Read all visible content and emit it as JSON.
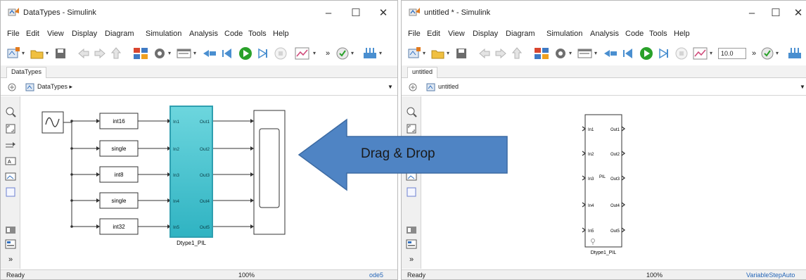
{
  "left_window": {
    "title": "DataTypes - Simulink",
    "menu": [
      "File",
      "Edit",
      "View",
      "Display",
      "Diagram",
      "Simulation",
      "Analysis",
      "Code",
      "Tools",
      "Help"
    ],
    "tab": "DataTypes",
    "address": "DataTypes",
    "status": {
      "ready": "Ready",
      "zoom": "100%",
      "solver": "ode5"
    },
    "diagram": {
      "converters": [
        "int16",
        "single",
        "int8",
        "single",
        "int32"
      ],
      "inports": [
        "In1",
        "In2",
        "In3",
        "In4",
        "In5"
      ],
      "outports": [
        "Out1",
        "Out2",
        "Out3",
        "Out4",
        "Out5"
      ],
      "subsystem_name": "Dtype1_PIL"
    }
  },
  "right_window": {
    "title": "untitled * - Simulink",
    "menu": [
      "File",
      "Edit",
      "View",
      "Display",
      "Diagram",
      "Simulation",
      "Analysis",
      "Code",
      "Tools",
      "Help"
    ],
    "tab": "untitled",
    "address": "untitled",
    "stop_time": "10.0",
    "status": {
      "ready": "Ready",
      "zoom": "100%",
      "solver": "VariableStepAuto"
    },
    "diagram": {
      "inports": [
        "In1",
        "In2",
        "In3",
        "In4",
        "In5"
      ],
      "outports": [
        "Out1",
        "Out2",
        "Out3",
        "Out4",
        "Out5"
      ],
      "badge": "PIL",
      "block_name": "Dtype1_PIL"
    }
  },
  "window_controls": {
    "minimize": "–",
    "maximize": "☐",
    "close": "✕"
  },
  "overlay": {
    "label": "Drag & Drop"
  },
  "colors": {
    "subsystem_fill": "#4fc8d4",
    "subsystem_border": "#2e9fb0",
    "arrow_fill": "#4f84c4",
    "arrow_border": "#3d6ba3",
    "solver_link": "#2566b8"
  }
}
